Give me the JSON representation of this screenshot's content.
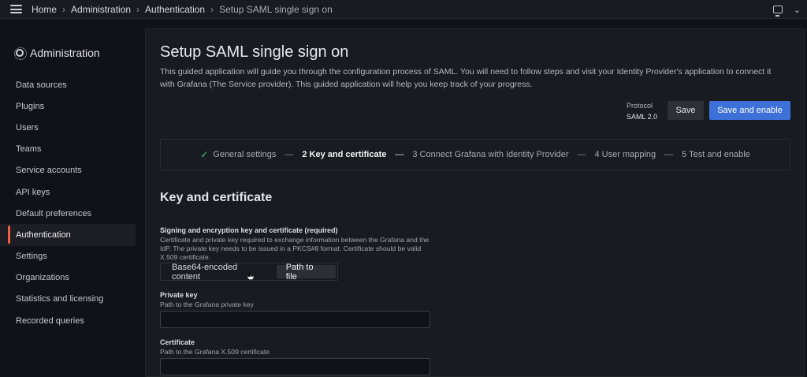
{
  "breadcrumb": {
    "items": [
      "Home",
      "Administration",
      "Authentication",
      "Setup SAML single sign on"
    ]
  },
  "sidebar": {
    "title": "Administration",
    "items": [
      {
        "label": "Data sources"
      },
      {
        "label": "Plugins"
      },
      {
        "label": "Users"
      },
      {
        "label": "Teams"
      },
      {
        "label": "Service accounts"
      },
      {
        "label": "API keys"
      },
      {
        "label": "Default preferences"
      },
      {
        "label": "Authentication",
        "active": true
      },
      {
        "label": "Settings"
      },
      {
        "label": "Organizations"
      },
      {
        "label": "Statistics and licensing"
      },
      {
        "label": "Recorded queries"
      }
    ]
  },
  "page": {
    "title": "Setup SAML single sign on",
    "intro": "This guided application will guide you through the configuration process of SAML. You will need to follow steps and visit your Identity Provider's application to connect it with Grafana (The Service provider). This guided application will help you keep track of your progress.",
    "protocol_label": "Protocol",
    "protocol_value": "SAML 2.0",
    "save_label": "Save",
    "save_enable_label": "Save and enable"
  },
  "stepper": {
    "steps": [
      {
        "label": "General settings",
        "state": "done"
      },
      {
        "label": "2 Key and certificate",
        "state": "active"
      },
      {
        "label": "3 Connect Grafana with Identity Provider",
        "state": "pending"
      },
      {
        "label": "4 User mapping",
        "state": "pending"
      },
      {
        "label": "5 Test and enable",
        "state": "pending"
      }
    ]
  },
  "section": {
    "title": "Key and certificate",
    "signing_label": "Signing and encryption key and certificate (required)",
    "signing_desc": "Certificate and private key required to exchange information between the Grafana and the IdP. The private key needs to be issued in a PKCS#8 format. Certificate should be valid X.509 certificate.",
    "option_base64": "Base64-encoded content",
    "option_path": "Path to file",
    "private_key_label": "Private key",
    "private_key_desc": "Path to the Grafana private key",
    "private_key_value": "",
    "certificate_label": "Certificate",
    "certificate_desc": "Path to the Grafana X.509 certificate",
    "certificate_value": ""
  },
  "colors": {
    "primary": "#3d71d9",
    "active_indicator": "#f55f3e",
    "success": "#45c37e"
  }
}
